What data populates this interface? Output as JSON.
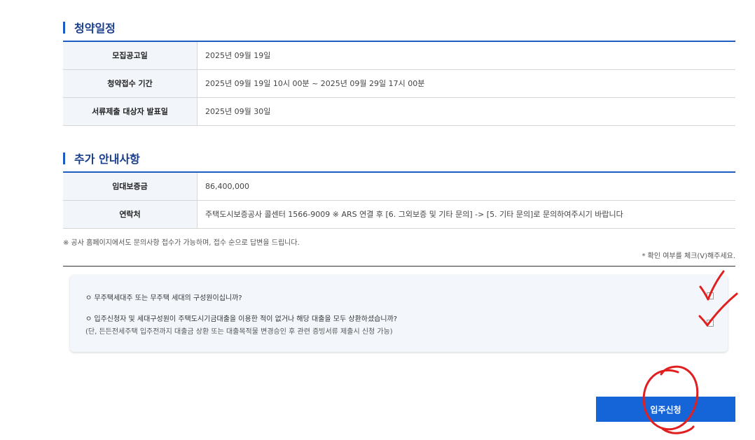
{
  "schedule": {
    "title": "청약일정",
    "rows": [
      {
        "label": "모집공고일",
        "value": "2025년 09월 19일"
      },
      {
        "label": "청약접수 기간",
        "value": "2025년 09월 19일 10시 00분 ~ 2025년 09월 29일 17시 00분"
      },
      {
        "label": "서류제출 대상자 발표일",
        "value": "2025년 09월 30일"
      }
    ]
  },
  "additional": {
    "title": "추가 안내사항",
    "rows": [
      {
        "label": "임대보증금",
        "value": "86,400,000"
      },
      {
        "label": "연락처",
        "value": "주택도시보증공사 콜센터 1566-9009 ※ ARS 연결 후 [6. 그외보증 및 기타 문의] -> [5. 기타 문의]로 문의하여주시기 바랍니다"
      }
    ]
  },
  "note": "※ 공사 홈페이지에서도 문의사항 접수가 가능하며, 접수 순으로 답변을 드립니다.",
  "confirm_hint": "* 확인 여부를 체크(V)해주세요.",
  "checklist": {
    "q1": "ㅇ 무주택세대주 또는 무주택 세대의 구성원이십니까?",
    "q2": "ㅇ 입주신청자 및 세대구성원이 주택도시기금대출을 이용한 적이 없거나 해당 대출을 모두 상환하셨습니까?",
    "q2_sub": "(단, 든든전세주택 입주전까지 대출금 상환 또는 대출목적물 변경승인 후 관련 증빙서류 제출시 신청 가능)"
  },
  "apply_button": "입주신청",
  "annotation_color": "#e02020"
}
